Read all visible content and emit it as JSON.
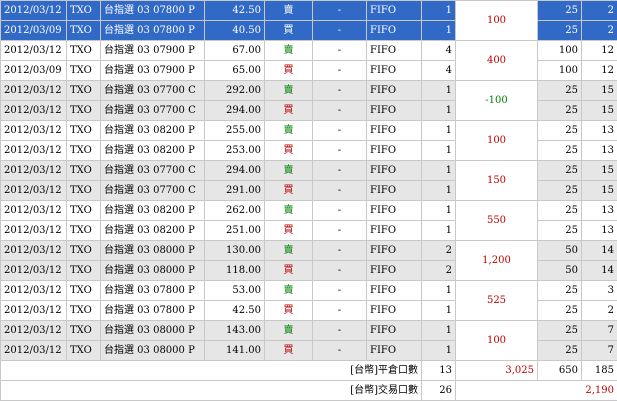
{
  "trades": [
    {
      "date": "2012/03/12",
      "code": "TXO",
      "option": "台指選 03 07800 P",
      "price": "42.50",
      "side": "賣",
      "dash": "-",
      "method": "FIFO",
      "qty": "1",
      "c1": "25",
      "c2": "2"
    },
    {
      "date": "2012/03/09",
      "code": "TXO",
      "option": "台指選 03 07800 P",
      "price": "40.50",
      "side": "買",
      "dash": "-",
      "method": "FIFO",
      "qty": "1",
      "c1": "25",
      "c2": "2"
    },
    {
      "date": "2012/03/12",
      "code": "TXO",
      "option": "台指選 03 07900 P",
      "price": "67.00",
      "side": "賣",
      "dash": "-",
      "method": "FIFO",
      "qty": "4",
      "c1": "100",
      "c2": "12"
    },
    {
      "date": "2012/03/09",
      "code": "TXO",
      "option": "台指選 03 07900 P",
      "price": "65.00",
      "side": "買",
      "dash": "-",
      "method": "FIFO",
      "qty": "4",
      "c1": "100",
      "c2": "12"
    },
    {
      "date": "2012/03/12",
      "code": "TXO",
      "option": "台指選 03 07700 C",
      "price": "292.00",
      "side": "賣",
      "dash": "-",
      "method": "FIFO",
      "qty": "1",
      "c1": "25",
      "c2": "15"
    },
    {
      "date": "2012/03/12",
      "code": "TXO",
      "option": "台指選 03 07700 C",
      "price": "294.00",
      "side": "買",
      "dash": "-",
      "method": "FIFO",
      "qty": "1",
      "c1": "25",
      "c2": "15"
    },
    {
      "date": "2012/03/12",
      "code": "TXO",
      "option": "台指選 03 08200 P",
      "price": "255.00",
      "side": "賣",
      "dash": "-",
      "method": "FIFO",
      "qty": "1",
      "c1": "25",
      "c2": "13"
    },
    {
      "date": "2012/03/12",
      "code": "TXO",
      "option": "台指選 03 08200 P",
      "price": "253.00",
      "side": "買",
      "dash": "-",
      "method": "FIFO",
      "qty": "1",
      "c1": "25",
      "c2": "13"
    },
    {
      "date": "2012/03/12",
      "code": "TXO",
      "option": "台指選 03 07700 C",
      "price": "294.00",
      "side": "賣",
      "dash": "-",
      "method": "FIFO",
      "qty": "1",
      "c1": "25",
      "c2": "15"
    },
    {
      "date": "2012/03/12",
      "code": "TXO",
      "option": "台指選 03 07700 C",
      "price": "291.00",
      "side": "買",
      "dash": "-",
      "method": "FIFO",
      "qty": "1",
      "c1": "25",
      "c2": "15"
    },
    {
      "date": "2012/03/12",
      "code": "TXO",
      "option": "台指選 03 08200 P",
      "price": "262.00",
      "side": "賣",
      "dash": "-",
      "method": "FIFO",
      "qty": "1",
      "c1": "25",
      "c2": "13"
    },
    {
      "date": "2012/03/12",
      "code": "TXO",
      "option": "台指選 03 08200 P",
      "price": "251.00",
      "side": "買",
      "dash": "-",
      "method": "FIFO",
      "qty": "1",
      "c1": "25",
      "c2": "13"
    },
    {
      "date": "2012/03/12",
      "code": "TXO",
      "option": "台指選 03 08000 P",
      "price": "130.00",
      "side": "賣",
      "dash": "-",
      "method": "FIFO",
      "qty": "2",
      "c1": "50",
      "c2": "14"
    },
    {
      "date": "2012/03/12",
      "code": "TXO",
      "option": "台指選 03 08000 P",
      "price": "118.00",
      "side": "買",
      "dash": "-",
      "method": "FIFO",
      "qty": "2",
      "c1": "50",
      "c2": "14"
    },
    {
      "date": "2012/03/12",
      "code": "TXO",
      "option": "台指選 03 07800 P",
      "price": "53.00",
      "side": "賣",
      "dash": "-",
      "method": "FIFO",
      "qty": "1",
      "c1": "25",
      "c2": "3"
    },
    {
      "date": "2012/03/12",
      "code": "TXO",
      "option": "台指選 03 07800 P",
      "price": "42.50",
      "side": "買",
      "dash": "-",
      "method": "FIFO",
      "qty": "1",
      "c1": "25",
      "c2": "2"
    },
    {
      "date": "2012/03/12",
      "code": "TXO",
      "option": "台指選 03 08000 P",
      "price": "143.00",
      "side": "賣",
      "dash": "-",
      "method": "FIFO",
      "qty": "1",
      "c1": "25",
      "c2": "7"
    },
    {
      "date": "2012/03/12",
      "code": "TXO",
      "option": "台指選 03 08000 P",
      "price": "141.00",
      "side": "買",
      "dash": "-",
      "method": "FIFO",
      "qty": "1",
      "c1": "25",
      "c2": "7"
    }
  ],
  "pairs": [
    {
      "pl": "100",
      "sign": "pos"
    },
    {
      "pl": "400",
      "sign": "pos"
    },
    {
      "pl": "-100",
      "sign": "neg"
    },
    {
      "pl": "100",
      "sign": "pos"
    },
    {
      "pl": "150",
      "sign": "pos"
    },
    {
      "pl": "550",
      "sign": "pos"
    },
    {
      "pl": "1,200",
      "sign": "pos"
    },
    {
      "pl": "525",
      "sign": "pos"
    },
    {
      "pl": "100",
      "sign": "pos"
    }
  ],
  "selected_rows": [
    0,
    1
  ],
  "pair_shading": [
    "white",
    "white",
    "gray",
    "white",
    "gray",
    "white",
    "gray",
    "white",
    "gray"
  ],
  "summary": {
    "close_label": "[台幣]平倉口數",
    "close_qty": "13",
    "close_pl": "3,025",
    "close_c1": "650",
    "close_c2": "185",
    "trade_label": "[台幣]交易口數",
    "trade_qty": "26",
    "trade_total": "2,190"
  },
  "colors": {
    "sell": "#008000",
    "buy": "#c00000",
    "selected": "#3169c6",
    "shaded": "#e6e6e6"
  }
}
